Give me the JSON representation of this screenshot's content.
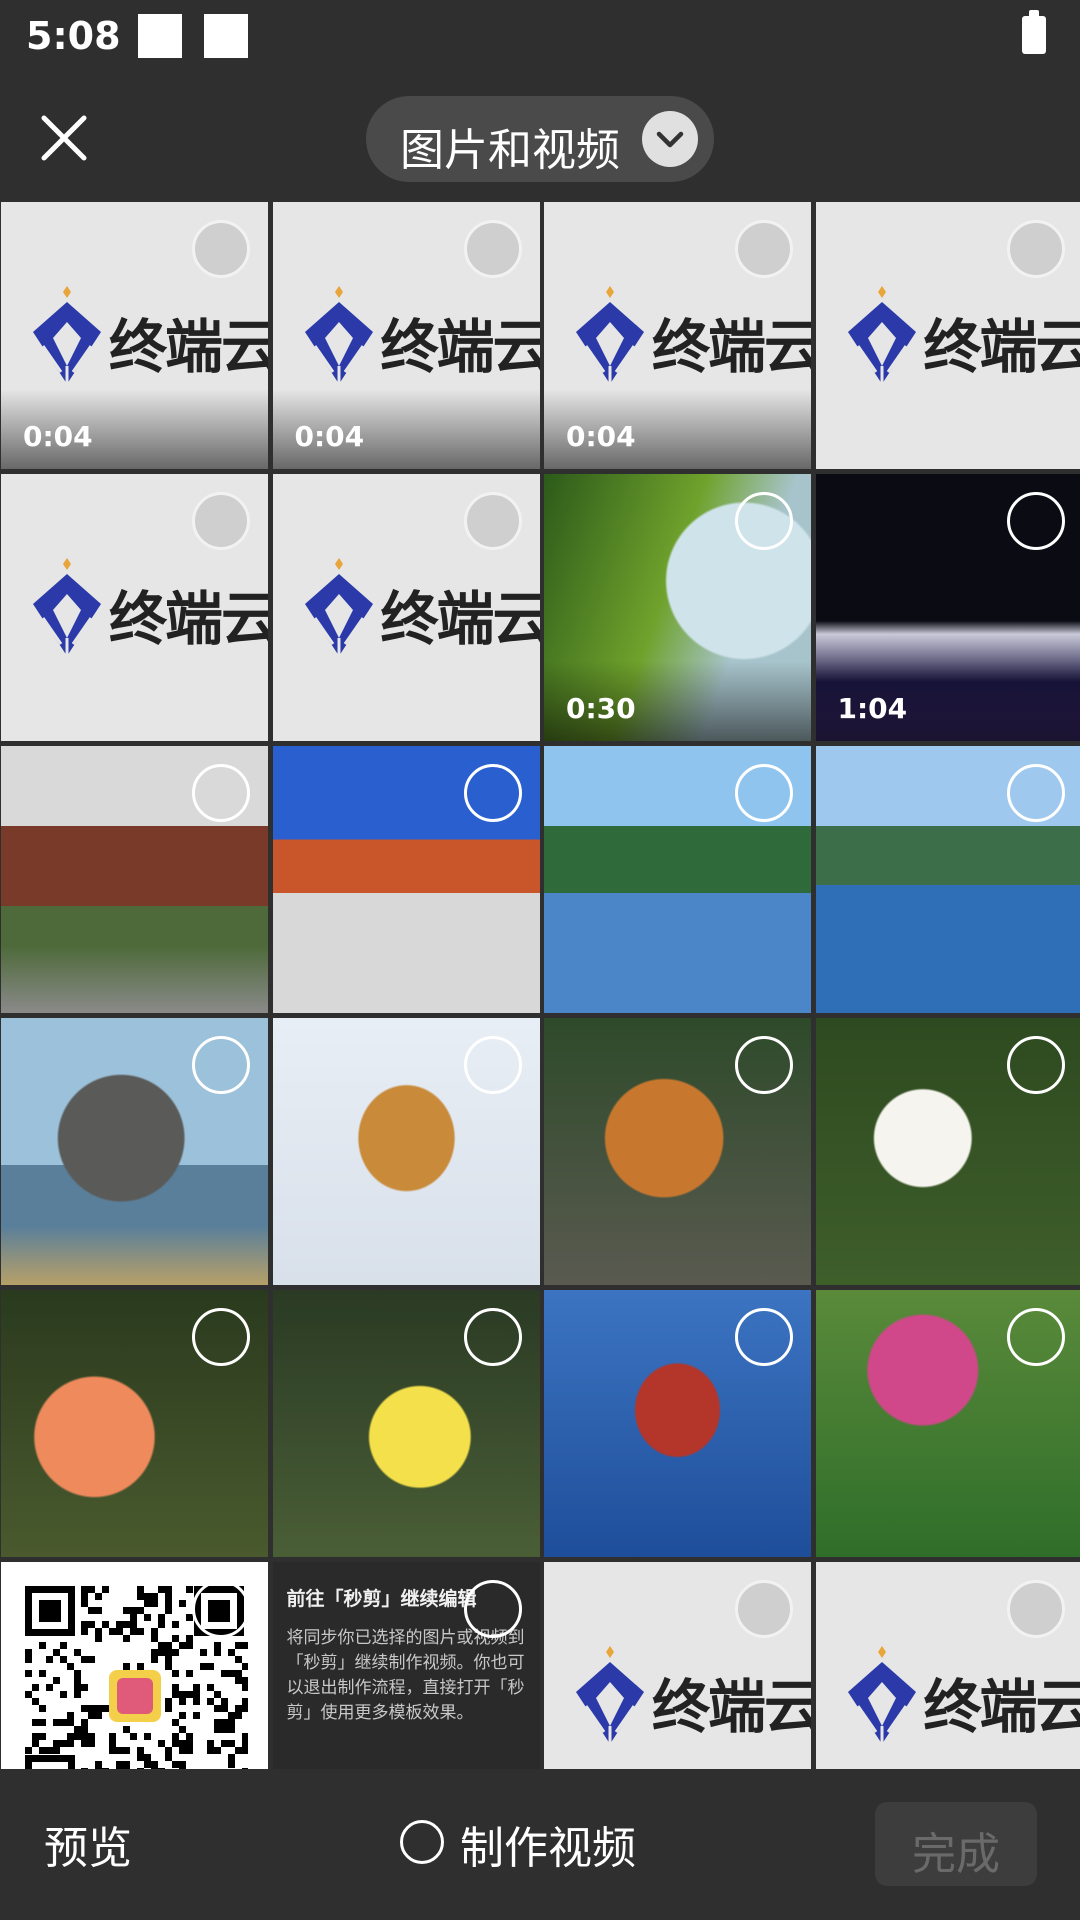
{
  "status_bar": {
    "time": "5:08"
  },
  "header": {
    "close_icon": "close-icon",
    "album_title": "图片和视频",
    "album_chevron": "chevron-down-icon"
  },
  "logo": {
    "text": "终端云测"
  },
  "grid_items": [
    {
      "kind": "logo",
      "duration": "0:04"
    },
    {
      "kind": "logo",
      "duration": "0:04"
    },
    {
      "kind": "logo",
      "duration": "0:04"
    },
    {
      "kind": "logo"
    },
    {
      "kind": "logo"
    },
    {
      "kind": "logo"
    },
    {
      "kind": "photo",
      "subject": "duck",
      "duration": "0:30"
    },
    {
      "kind": "photo",
      "subject": "concert stage",
      "duration": "1:04"
    },
    {
      "kind": "photo",
      "subject": "temple gate"
    },
    {
      "kind": "photo",
      "subject": "temple"
    },
    {
      "kind": "photo",
      "subject": "pagodas lake"
    },
    {
      "kind": "photo",
      "subject": "pagodas reflection"
    },
    {
      "kind": "photo",
      "subject": "elephant"
    },
    {
      "kind": "photo",
      "subject": "tiger snow"
    },
    {
      "kind": "photo",
      "subject": "tiger"
    },
    {
      "kind": "photo",
      "subject": "white rose"
    },
    {
      "kind": "photo",
      "subject": "orange rose"
    },
    {
      "kind": "photo",
      "subject": "yellow rose"
    },
    {
      "kind": "photo",
      "subject": "orchid"
    },
    {
      "kind": "photo",
      "subject": "pink flowers"
    },
    {
      "kind": "qr"
    },
    {
      "kind": "info",
      "title": "前往「秒剪」继续编辑",
      "body": "将同步你已选择的图片或视频到「秒剪」继续制作视频。你也可以退出制作流程，直接打开「秒剪」使用更多模板效果。"
    },
    {
      "kind": "logo"
    },
    {
      "kind": "logo"
    }
  ],
  "bottom_bar": {
    "preview_label": "预览",
    "make_video_label": "制作视频",
    "done_label": "完成"
  },
  "colors": {
    "background": "#2f2f2f",
    "pill": "#4a4a4a",
    "logo_blue": "#2b3aa8"
  }
}
